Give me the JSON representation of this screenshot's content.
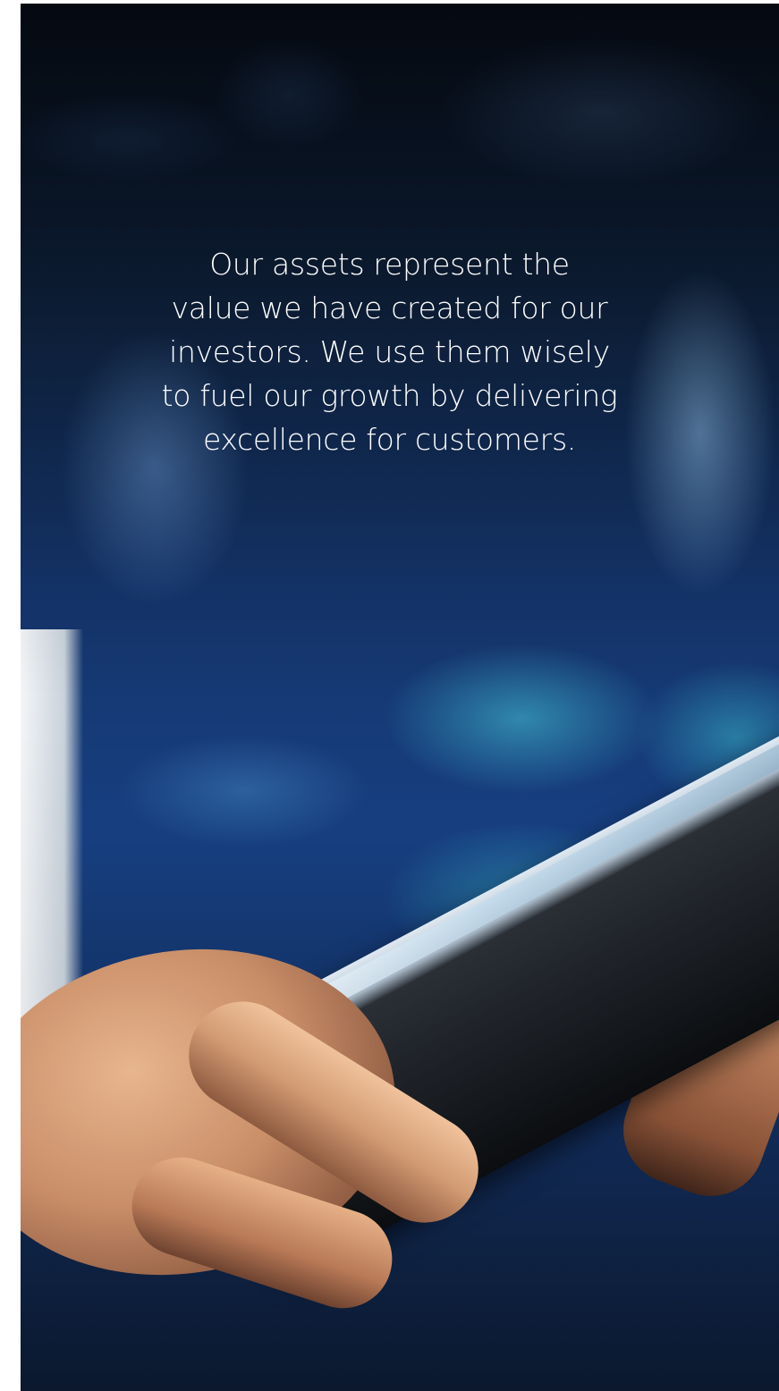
{
  "hero": {
    "image_alt": "hand tapping a tablet in front of blurred blue lights",
    "quote_lines": [
      "Our assets represent the",
      "value we have created for our",
      "investors. We use them wisely",
      "to fuel our growth by delivering",
      "excellence for customers."
    ]
  },
  "colors": {
    "background": "#ffffff",
    "hero_dark": "#0f2340",
    "hero_mid": "#174082",
    "text": "#ffffff"
  }
}
